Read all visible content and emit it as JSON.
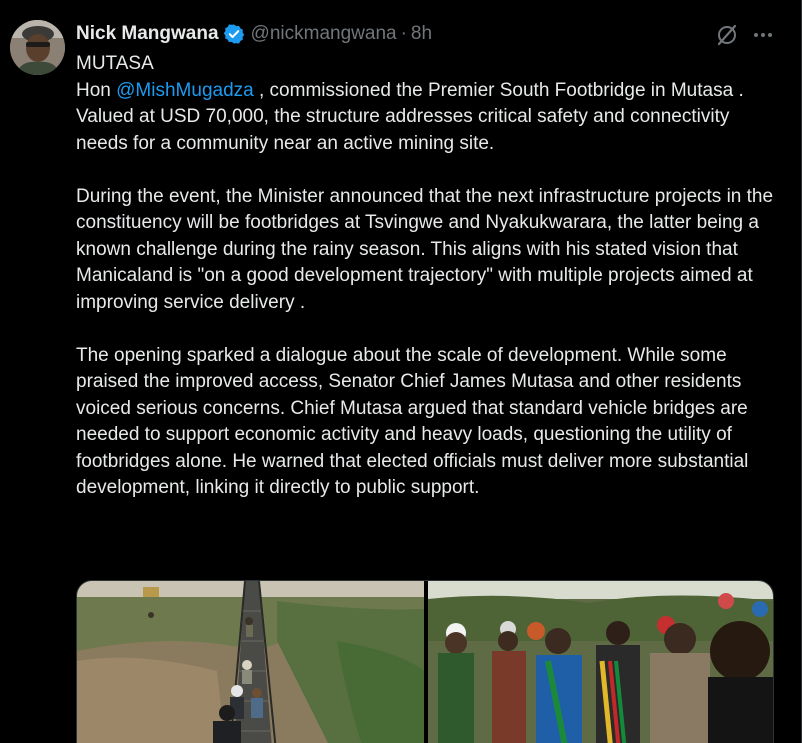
{
  "author": {
    "display_name": "Nick Mangwana",
    "handle": "@nickmangwana",
    "separator": "·",
    "time": "8h",
    "verified": true
  },
  "icons": {
    "verified": "verified-badge-icon",
    "grok": "grok-icon",
    "more": "more-options-icon"
  },
  "colors": {
    "background": "#000000",
    "text": "#e7e9ea",
    "secondary": "#71767b",
    "accent": "#1d9bf0"
  },
  "tweet": {
    "heading": "MUTASA",
    "p1_prefix": "Hon ",
    "p1_mention": "@MishMugadza",
    "p1_rest": " , commissioned the Premier South Footbridge in Mutasa . Valued at USD 70,000, the structure addresses critical safety and connectivity needs for a community near an active mining site.",
    "p2": "During the event, the Minister announced that the next infrastructure projects in the constituency will be footbridges at Tsvingwe and Nyakukwarara, the latter being a known challenge during the rainy season. This aligns with his stated vision that Manicaland is \"on a good development trajectory\" with multiple projects aimed at improving service delivery .",
    "p3": "The opening sparked a dialogue about the scale of development. While some praised the improved access, Senator Chief James Mutasa and other residents voiced serious concerns. Chief Mutasa argued that standard vehicle bridges are needed to support economic activity and heavy loads, questioning the utility of footbridges alone. He warned that elected officials must deliver more substantial development, linking it directly to public support."
  },
  "media": [
    {
      "kind": "photo",
      "subject": "footbridge-photo"
    },
    {
      "kind": "photo",
      "subject": "ribbon-cutting-crowd-photo"
    }
  ]
}
